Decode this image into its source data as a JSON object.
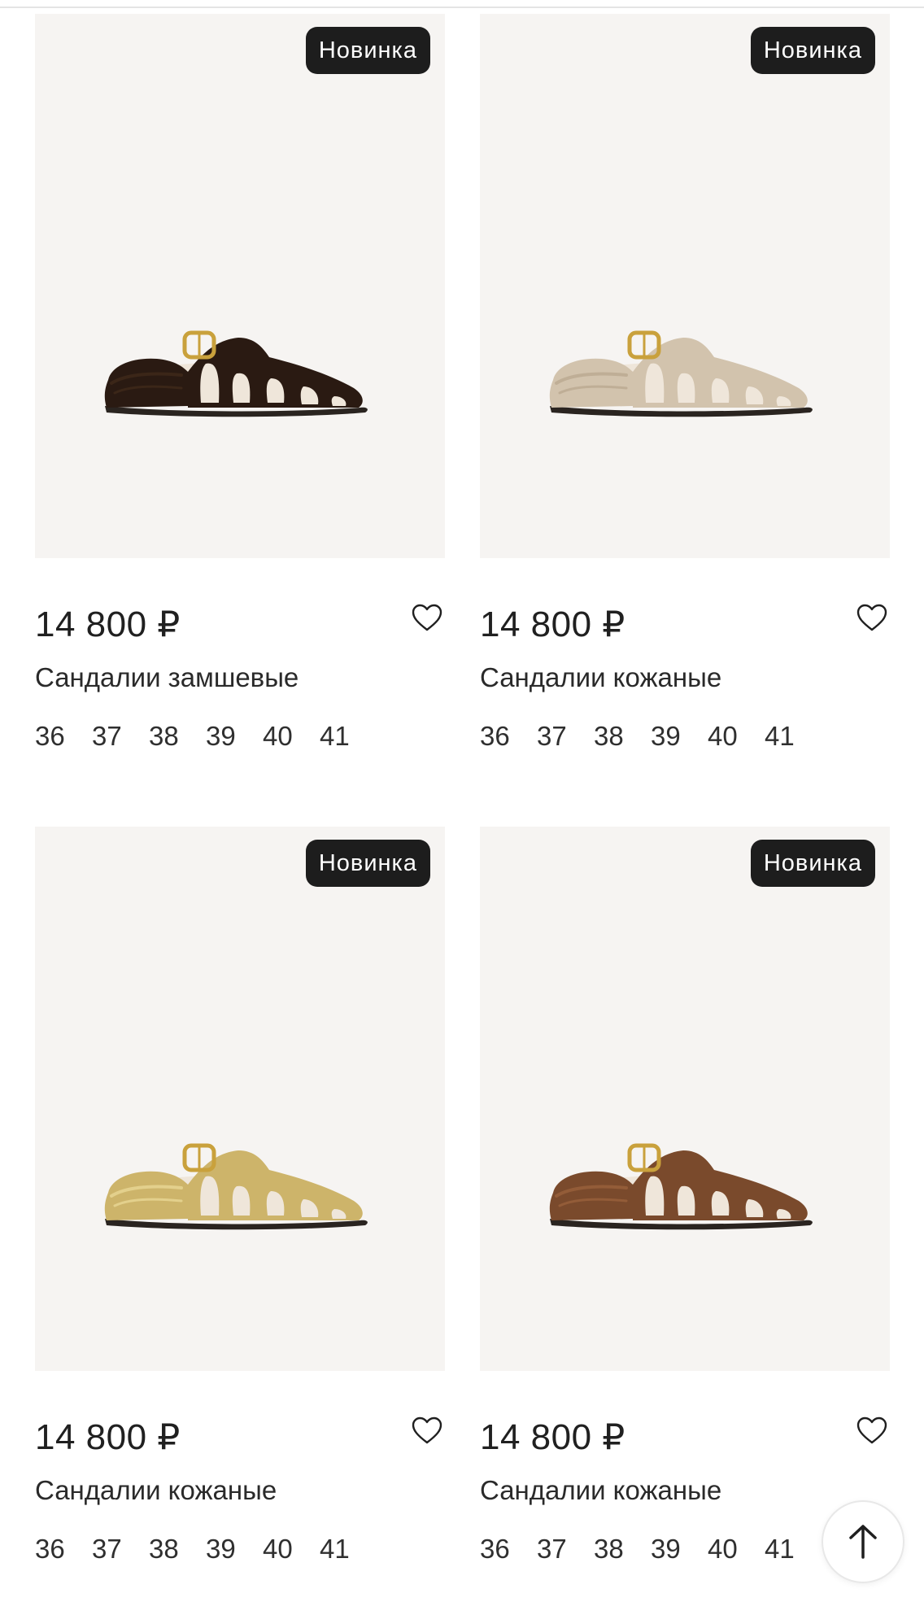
{
  "products": [
    {
      "badge": "Новинка",
      "price": "14 800 ₽",
      "name": "Сандалии замшевые",
      "sizes": [
        "36",
        "37",
        "38",
        "39",
        "40",
        "41"
      ],
      "shoe_color": "#2a1a12",
      "shoe_shade": "#3b2618",
      "favorite_icon": "heart-outline-icon"
    },
    {
      "badge": "Новинка",
      "price": "14 800 ₽",
      "name": "Сандалии кожаные",
      "sizes": [
        "36",
        "37",
        "38",
        "39",
        "40",
        "41"
      ],
      "shoe_color": "#d2c3ad",
      "shoe_shade": "#bfae96",
      "favorite_icon": "heart-outline-icon"
    },
    {
      "badge": "Новинка",
      "price": "14 800 ₽",
      "name": "Сандалии кожаные",
      "sizes": [
        "36",
        "37",
        "38",
        "39",
        "40",
        "41"
      ],
      "shoe_color": "#cdb46a",
      "shoe_shade": "#e3d08c",
      "favorite_icon": "heart-outline-icon"
    },
    {
      "badge": "Новинка",
      "price": "14 800 ₽",
      "name": "Сандалии кожаные",
      "sizes": [
        "36",
        "37",
        "38",
        "39",
        "40",
        "41"
      ],
      "shoe_color": "#7a4a2c",
      "shoe_shade": "#935c38",
      "favorite_icon": "heart-outline-icon"
    }
  ],
  "scroll_top_icon": "arrow-up-icon",
  "colors": {
    "badge_bg": "#1d1d1d",
    "photo_bg": "#f6f4f2",
    "text": "#1f1f1f"
  }
}
